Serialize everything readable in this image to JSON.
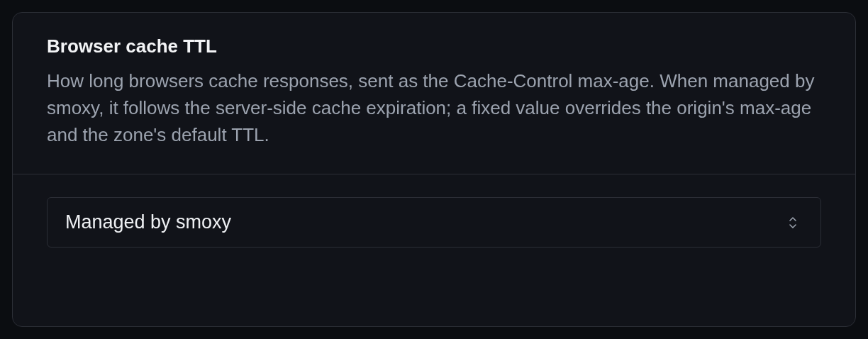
{
  "setting": {
    "title": "Browser cache TTL",
    "description": "How long browsers cache responses, sent as the Cache-Control max-age. When managed by smoxy, it follows the server-side cache expiration; a fixed value overrides the origin's max-age and the zone's default TTL.",
    "select": {
      "value": "Managed by smoxy"
    }
  }
}
